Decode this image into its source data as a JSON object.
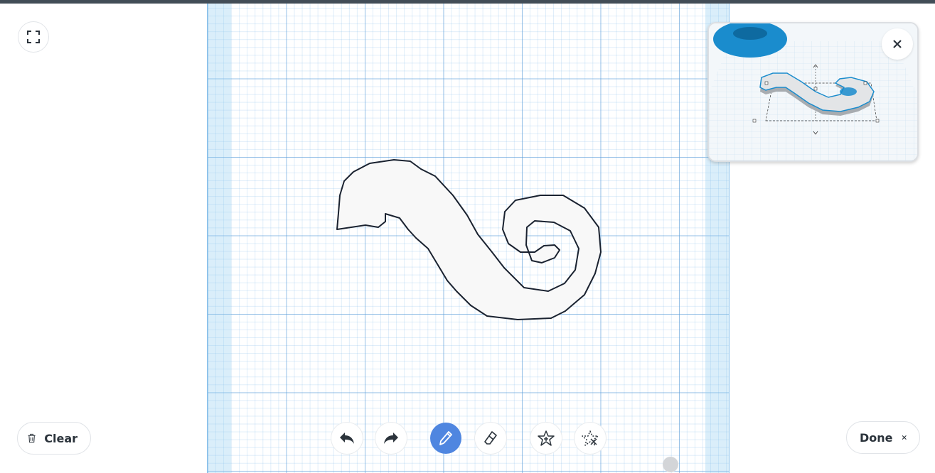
{
  "toolbar": {
    "clear_label": "Clear",
    "done_label": "Done",
    "tools": [
      {
        "name": "undo",
        "icon": "undo-icon"
      },
      {
        "name": "redo",
        "icon": "redo-icon"
      },
      {
        "name": "pencil",
        "icon": "pencil-icon",
        "active": true
      },
      {
        "name": "eraser",
        "icon": "eraser-icon"
      },
      {
        "name": "add-shape",
        "icon": "star-add-icon"
      },
      {
        "name": "remove-shape",
        "icon": "star-remove-icon"
      }
    ]
  },
  "icons": {
    "fullscreen": "fullscreen-icon",
    "trash": "trash-icon",
    "close": "close-icon"
  },
  "colors": {
    "accent": "#4f86e0",
    "grid": "#5a9bd7",
    "shape_fill": "#f8f8f8",
    "shape_stroke": "#1a2230",
    "preview_blue": "#1a8ccd",
    "topbar": "#424d57"
  }
}
